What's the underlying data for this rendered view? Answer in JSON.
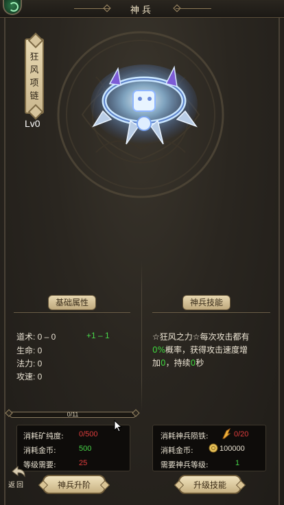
{
  "header": {
    "title": "神兵"
  },
  "artifact": {
    "name": "狂风项链",
    "level": "Lv0"
  },
  "attributes": {
    "section_title": "基础属性",
    "rows": [
      {
        "label": "道术: 0 – 0"
      },
      {
        "label": "生命: 0"
      },
      {
        "label": "法力: 0"
      },
      {
        "label": "攻速: 0"
      }
    ],
    "bonus": "+1 – 1"
  },
  "skill": {
    "section_title": "神兵技能",
    "desc_1": "☆狂风之力☆每次攻击都有",
    "desc_pct": "0%",
    "desc_2": "概率，获得攻击速度增",
    "desc_3": "加",
    "desc_val": "0",
    "desc_4": "，持续",
    "desc_dur": "0",
    "desc_5": "秒"
  },
  "progress": {
    "text": "0/11",
    "fraction": 0
  },
  "upgrade_cost": {
    "purity_label": "消耗矿纯度:",
    "purity_value": "0/500",
    "gold_label": "消耗金币:",
    "gold_value": "500",
    "level_label": "等级需要:",
    "level_value": "25"
  },
  "skill_cost": {
    "meteor_label": "消耗神兵陨铁:",
    "meteor_value": "0/20",
    "gold_label": "消耗金币:",
    "gold_value": "100000",
    "level_label": "需要神兵等级:",
    "level_value": "1"
  },
  "buttons": {
    "upgrade": "神兵升阶",
    "skill_upgrade": "升级技能",
    "back": "返回"
  },
  "colors": {
    "accent_gold": "#c9a85a",
    "value_red": "#e03d3d",
    "value_green": "#47d548"
  }
}
